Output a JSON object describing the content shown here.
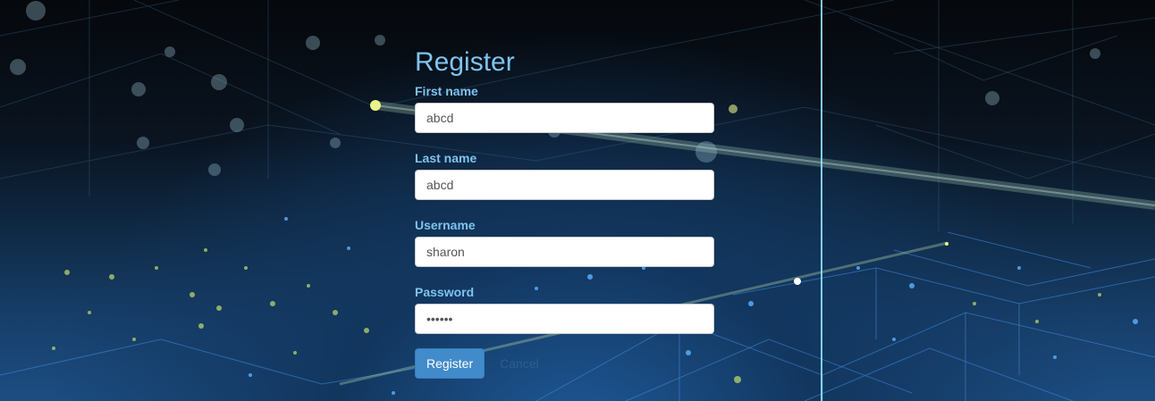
{
  "form": {
    "title": "Register",
    "fields": [
      {
        "label": "First name",
        "value": "abcd",
        "type": "text"
      },
      {
        "label": "Last name",
        "value": "abcd",
        "type": "text"
      },
      {
        "label": "Username",
        "value": "sharon",
        "type": "text"
      },
      {
        "label": "Password",
        "value": "••••••",
        "type": "password"
      }
    ],
    "submit_label": "Register",
    "cancel_label": "Cancel"
  },
  "colors": {
    "label": "#7ec3ef",
    "button": "#428bca",
    "cancel_link": "#2a5f8f"
  }
}
